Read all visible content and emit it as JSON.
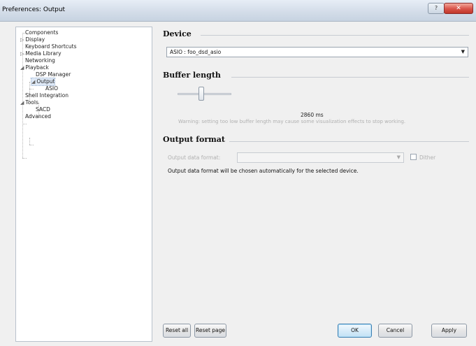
{
  "window": {
    "title": "Preferences: Output",
    "help_label": "?",
    "close_label": "✕"
  },
  "tree": {
    "items": [
      {
        "label": "Components",
        "glyph": ""
      },
      {
        "label": "Display",
        "glyph": "▷"
      },
      {
        "label": "Keyboard Shortcuts",
        "glyph": ""
      },
      {
        "label": "Media Library",
        "glyph": "▷"
      },
      {
        "label": "Networking",
        "glyph": ""
      },
      {
        "label": "Playback",
        "glyph": "◢"
      },
      {
        "label": "DSP Manager",
        "glyph": ""
      },
      {
        "label": "Output",
        "glyph": "◢"
      },
      {
        "label": "ASIO",
        "glyph": ""
      },
      {
        "label": "Shell Integration",
        "glyph": ""
      },
      {
        "label": "Tools",
        "glyph": "◢"
      },
      {
        "label": "SACD",
        "glyph": ""
      },
      {
        "label": "Advanced",
        "glyph": ""
      }
    ]
  },
  "device": {
    "heading": "Device",
    "value": "ASIO : foo_dsd_asio"
  },
  "buffer": {
    "heading": "Buffer length",
    "value_text": "2860 ms",
    "warning": "Warning: setting too low buffer length may cause some visualization effects to stop working."
  },
  "output_format": {
    "heading": "Output format",
    "data_format_label": "Output data format:",
    "data_format_value": "",
    "dither_label": "Dither",
    "info": "Output data format will be chosen automatically for the selected device."
  },
  "buttons": {
    "reset_all": "Reset all",
    "reset_page": "Reset page",
    "ok": "OK",
    "cancel": "Cancel",
    "apply": "Apply"
  }
}
